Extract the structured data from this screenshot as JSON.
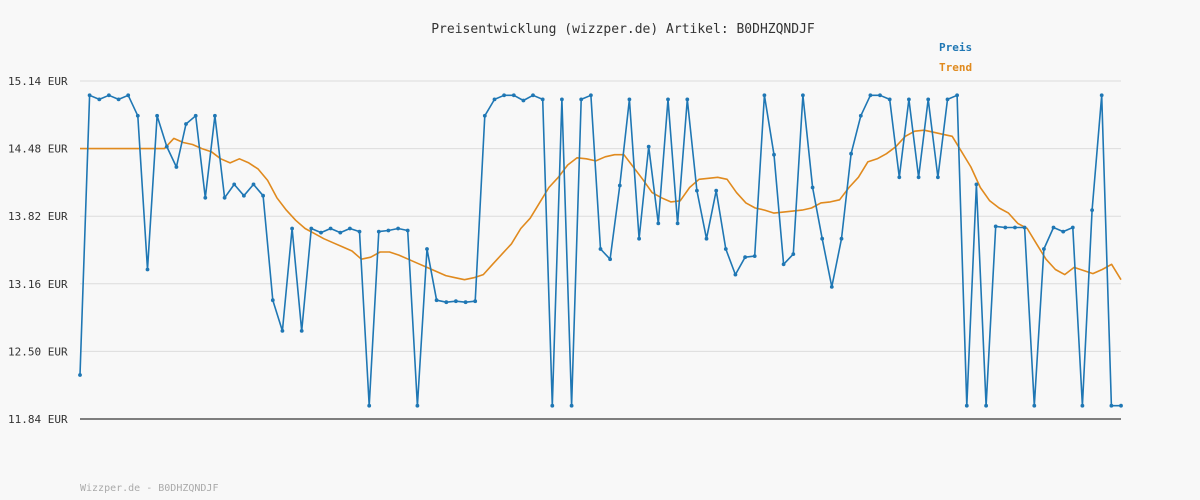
{
  "chart_data": {
    "type": "line",
    "title": "Preisentwicklung (wizzper.de) Artikel: B0DHZQNDJF",
    "footer": "Wizzper.de - B0DHZQNDJF",
    "y_unit": "EUR",
    "ylim": [
      11.84,
      15.14
    ],
    "y_ticks": [
      "15.14 EUR",
      "14.48 EUR",
      "13.82 EUR",
      "13.16 EUR",
      "12.50 EUR",
      "11.84 EUR"
    ],
    "grid": true,
    "legend_position": "top-right",
    "colors": {
      "Preis": "#1f77b4",
      "Trend": "#e08a1e"
    },
    "series": [
      {
        "name": "Preis",
        "values": [
          12.27,
          15.0,
          14.96,
          15.0,
          14.96,
          15.0,
          14.8,
          13.3,
          14.8,
          14.5,
          14.3,
          14.72,
          14.8,
          14.0,
          14.8,
          14.0,
          14.13,
          14.02,
          14.13,
          14.02,
          13.0,
          12.7,
          13.7,
          12.7,
          13.7,
          13.66,
          13.7,
          13.66,
          13.7,
          13.67,
          11.97,
          13.67,
          13.68,
          13.7,
          13.68,
          11.97,
          13.5,
          13.0,
          12.98,
          12.99,
          12.98,
          12.99,
          14.8,
          14.96,
          15.0,
          15.0,
          14.95,
          15.0,
          14.96,
          11.97,
          14.96,
          11.97,
          14.96,
          15.0,
          13.5,
          13.4,
          14.12,
          14.96,
          13.6,
          14.5,
          13.75,
          14.96,
          13.75,
          14.96,
          14.07,
          13.6,
          14.07,
          13.5,
          13.25,
          13.42,
          13.43,
          15.0,
          14.42,
          13.35,
          13.45,
          15.0,
          14.1,
          13.6,
          13.13,
          13.6,
          14.43,
          14.8,
          15.0,
          15.0,
          14.96,
          14.2,
          14.96,
          14.2,
          14.96,
          14.2,
          14.96,
          15.0,
          11.97,
          14.13,
          11.97,
          13.72,
          13.71,
          13.71,
          13.71,
          11.97,
          13.5,
          13.71,
          13.67,
          13.71,
          11.97,
          13.88,
          15.0,
          11.97,
          11.97
        ]
      },
      {
        "name": "Trend",
        "values": [
          14.48,
          14.48,
          14.48,
          14.48,
          14.48,
          14.48,
          14.48,
          14.48,
          14.48,
          14.48,
          14.58,
          14.54,
          14.52,
          14.48,
          14.45,
          14.38,
          14.34,
          14.38,
          14.34,
          14.28,
          14.17,
          14.0,
          13.88,
          13.78,
          13.7,
          13.65,
          13.6,
          13.56,
          13.52,
          13.48,
          13.4,
          13.42,
          13.47,
          13.47,
          13.44,
          13.4,
          13.36,
          13.32,
          13.28,
          13.24,
          13.22,
          13.2,
          13.22,
          13.25,
          13.35,
          13.45,
          13.55,
          13.7,
          13.8,
          13.95,
          14.1,
          14.2,
          14.32,
          14.39,
          14.38,
          14.36,
          14.4,
          14.42,
          14.42,
          14.3,
          14.18,
          14.05,
          14.0,
          13.96,
          13.97,
          14.1,
          14.18,
          14.19,
          14.2,
          14.18,
          14.05,
          13.95,
          13.9,
          13.88,
          13.85,
          13.86,
          13.87,
          13.88,
          13.9,
          13.95,
          13.96,
          13.98,
          14.1,
          14.2,
          14.35,
          14.38,
          14.43,
          14.5,
          14.6,
          14.65,
          14.66,
          14.64,
          14.62,
          14.6,
          14.45,
          14.3,
          14.1,
          13.97,
          13.9,
          13.85,
          13.75,
          13.7,
          13.55,
          13.4,
          13.3,
          13.25,
          13.32,
          13.29,
          13.26,
          13.3,
          13.35,
          13.2
        ]
      }
    ]
  }
}
